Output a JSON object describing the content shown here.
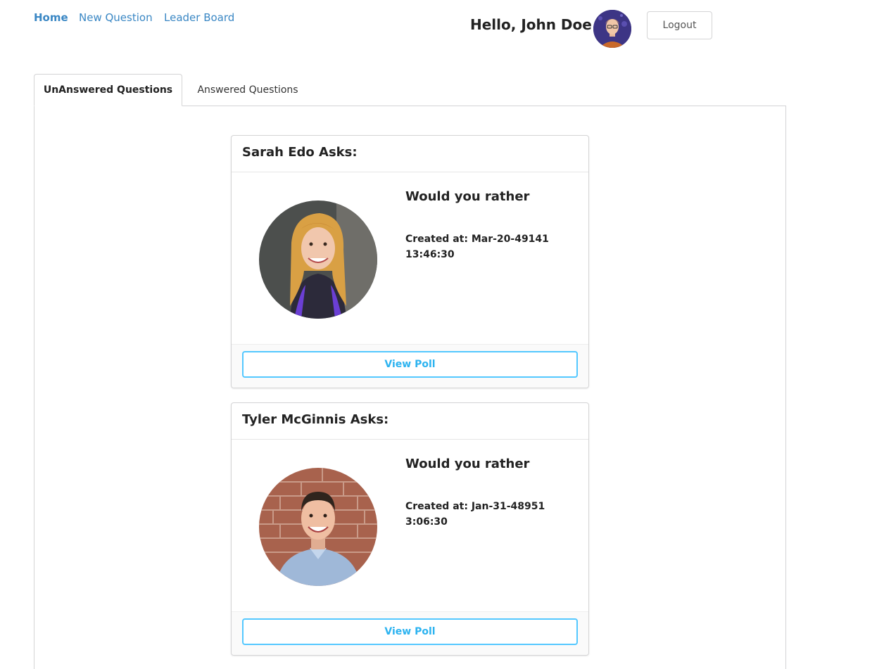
{
  "nav": {
    "items": [
      {
        "label": "Home",
        "active": true
      },
      {
        "label": "New Question",
        "active": false
      },
      {
        "label": "Leader Board",
        "active": false
      }
    ]
  },
  "user": {
    "greeting": "Hello, John Doe",
    "logout_label": "Logout"
  },
  "tabs": [
    {
      "label": "UnAnswered Questions",
      "active": true
    },
    {
      "label": "Answered Questions",
      "active": false
    }
  ],
  "questions": [
    {
      "author_label": "Sarah Edo Asks:",
      "title": "Would you rather",
      "created": "Created at: Mar-20-49141 13:46:30",
      "button_label": "View Poll"
    },
    {
      "author_label": "Tyler McGinnis Asks:",
      "title": "Would you rather",
      "created": "Created at: Jan-31-48951 3:06:30",
      "button_label": "View Poll"
    }
  ],
  "colors": {
    "link": "#3a87c4",
    "button_accent": "#54c8ff",
    "border": "#d4d4d5"
  }
}
